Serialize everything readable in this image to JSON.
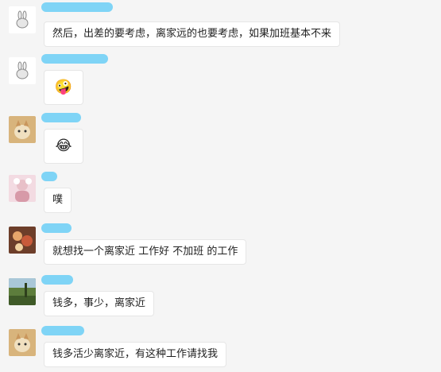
{
  "messages": [
    {
      "avatar": "rabbit-sketch-avatar",
      "text": "然后，出差的要考虑，离家远的也要考虑，如果加班基本不来"
    },
    {
      "avatar": "rabbit-sketch-avatar",
      "emoji": "face-with-tongue-emoji",
      "text": "🤪"
    },
    {
      "avatar": "cat-photo-avatar",
      "emoji": "tears-of-joy-emoji",
      "text": "😂"
    },
    {
      "avatar": "pink-photo-avatar",
      "text": "噗"
    },
    {
      "avatar": "food-photo-avatar",
      "text": "就想找一个离家近 工作好 不加班 的工作"
    },
    {
      "avatar": "landscape-photo-avatar",
      "text": "钱多，事少，离家近"
    },
    {
      "avatar": "cat-photo-avatar",
      "text": "钱多活少离家近，有这种工作请找我"
    }
  ],
  "colors": {
    "background": "#f5f5f5",
    "bubble": "#ffffff",
    "name_blur": "#7fd4f6"
  }
}
